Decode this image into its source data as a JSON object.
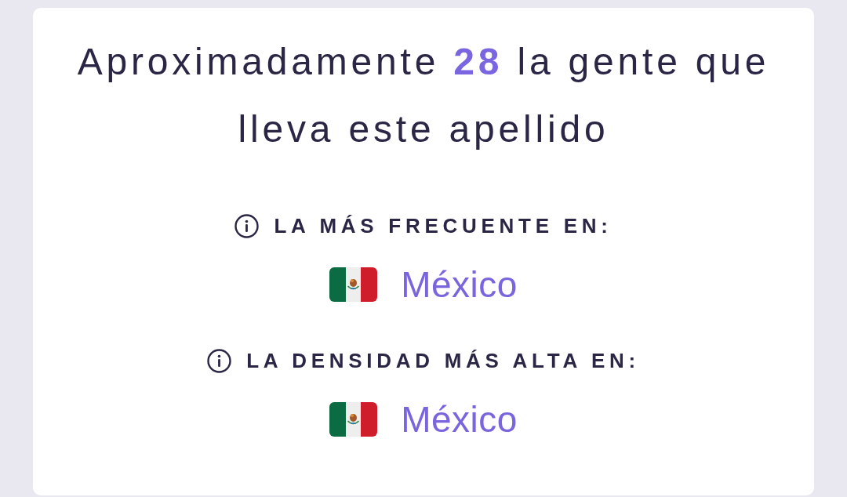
{
  "headline": "Aproximadamente **28** la gente que lleva este apellido",
  "sections": [
    {
      "heading": "LA MÁS FRECUENTE EN:",
      "country": "México"
    },
    {
      "heading": "LA DENSIDAD MÁS ALTA EN:",
      "country": "México"
    }
  ]
}
